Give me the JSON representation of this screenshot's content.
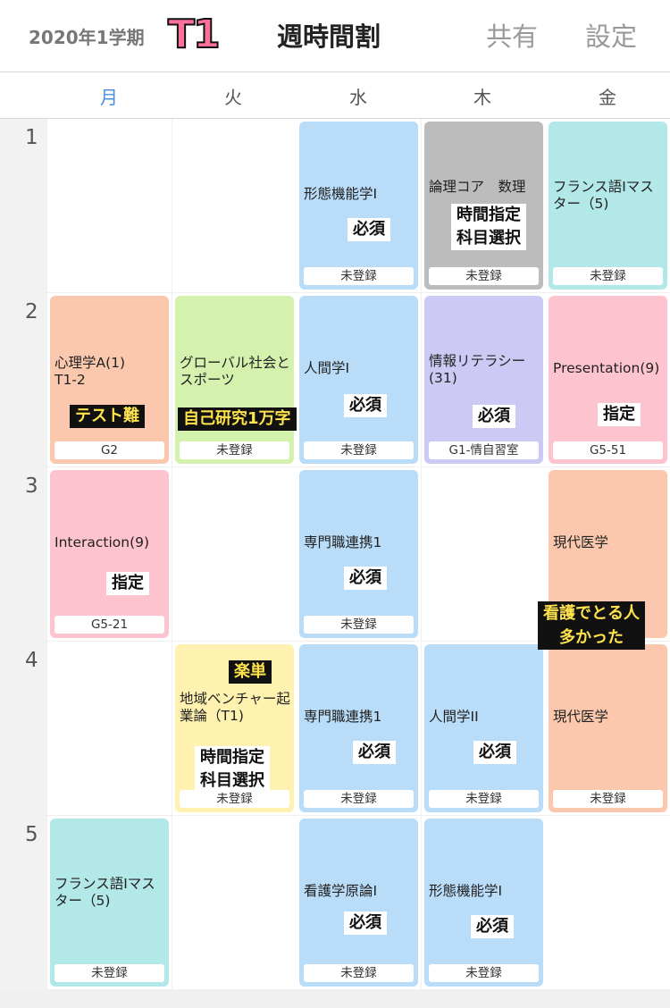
{
  "header": {
    "term": "2020年1学期",
    "logo_text": "T1",
    "title": "週時間割",
    "share_label": "共有",
    "settings_label": "設定"
  },
  "days": [
    "月",
    "火",
    "水",
    "木",
    "金"
  ],
  "periods": [
    "1",
    "2",
    "3",
    "4",
    "5"
  ],
  "classes": {
    "wed1": {
      "name": "形態機能学I",
      "room": "未登録",
      "tag": "必須"
    },
    "thu1": {
      "name": "論理コア　数理",
      "room": "未登録",
      "tag": "時間指定\n科目選択"
    },
    "fri1": {
      "name": "フランス語Iマスター（5)",
      "room": "未登録"
    },
    "mon2": {
      "name": "心理学A(1)\nT1-2",
      "room": "G2",
      "tag": "テスト難"
    },
    "tue2": {
      "name": "グローバル社会とスポーツ",
      "room": "未登録",
      "tag": "自己研究1万字"
    },
    "wed2": {
      "name": "人間学I",
      "room": "未登録",
      "tag": "必須"
    },
    "thu2": {
      "name": "情報リテラシー(31)",
      "room": "G1-情自習室",
      "tag": "必須"
    },
    "fri2": {
      "name": "Presentation(9)",
      "room": "G5-51",
      "tag": "指定"
    },
    "mon3": {
      "name": "Interaction(9)",
      "room": "G5-21",
      "tag": "指定"
    },
    "wed3": {
      "name": "専門職連携1",
      "room": "未登録",
      "tag": "必須"
    },
    "fri3": {
      "name": "現代医学",
      "tag": "看護でとる人\n多かった"
    },
    "tue4": {
      "name": "地域ベンチャー起業論（T1)",
      "room": "未登録",
      "tag_top": "楽単",
      "tag": "時間指定\n科目選択"
    },
    "wed4": {
      "name": "専門職連携1",
      "room": "未登録",
      "tag": "必須"
    },
    "thu4": {
      "name": "人間学II",
      "room": "未登録",
      "tag": "必須"
    },
    "fri4": {
      "name": "現代医学",
      "room": "未登録"
    },
    "mon5": {
      "name": "フランス語Iマスター（5)",
      "room": "未登録"
    },
    "wed5": {
      "name": "看護学原論I",
      "room": "未登録",
      "tag": "必須"
    },
    "thu5": {
      "name": "形態機能学I",
      "room": "未登録",
      "tag": "必須"
    }
  },
  "colors": {
    "blue": "#b9dcf8",
    "gray": "#bcbcbc",
    "teal": "#b2e8e7",
    "salmon": "#fcc8ad",
    "green": "#d4f2ad",
    "purple": "#cccaf4",
    "pink": "#fdc3cf",
    "yellow": "#fff2b0",
    "today": "#4a8fd8",
    "logo": "#ff6f9a"
  }
}
